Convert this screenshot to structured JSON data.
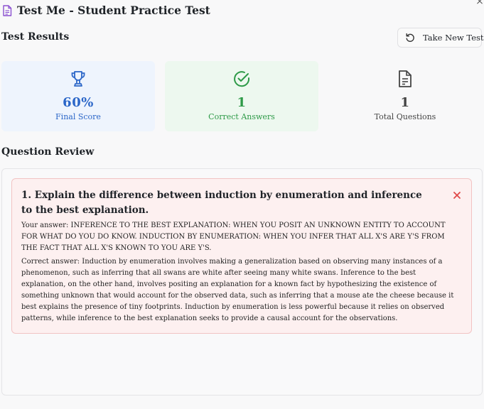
{
  "window": {
    "title": "Test Me - Student Practice Test",
    "icon": "document-icon",
    "close_label": "×"
  },
  "results": {
    "heading": "Test Results",
    "new_test_label": "Take New Test",
    "new_test_icon": "rotate-ccw-icon",
    "stats": [
      {
        "icon": "trophy-icon",
        "value": "60%",
        "label": "Final Score",
        "color": "#2b66c8"
      },
      {
        "icon": "check-circle-icon",
        "value": "1",
        "label": "Correct Answers",
        "color": "#2e9a48"
      },
      {
        "icon": "file-text-icon",
        "value": "1",
        "label": "Total Questions",
        "color": "#444444"
      }
    ]
  },
  "review": {
    "heading": "Question Review",
    "questions": [
      {
        "title": "1. Explain the difference between induction by enumeration and inference to the best explanation.",
        "status_icon": "x-icon",
        "status_color": "#e04848",
        "your_answer_prefix": "Your answer:",
        "your_answer": "INFERENCE TO THE BEST EXPLANATION: WHEN YOU POSIT AN UNKNOWN ENTITY TO ACCOUNT FOR WHAT DO YOU DO KNOW. INDUCTION BY ENUMERATION: WHEN YOU INFER THAT ALL X'S ARE Y'S FROM THE FACT THAT ALL X'S KNOWN TO YOU ARE Y'S.",
        "correct_answer_prefix": "Correct answer:",
        "correct_answer": "Induction by enumeration involves making a generalization based on observing many instances of a phenomenon, such as inferring that all swans are white after seeing many white swans. Inference to the best explanation, on the other hand, involves positing an explanation for a known fact by hypothesizing the existence of something unknown that would account for the observed data, such as inferring that a mouse ate the cheese because it best explains the presence of tiny footprints. Induction by enumeration is less powerful because it relies on observed patterns, while inference to the best explanation seeks to provide a causal account for the observations."
      }
    ]
  }
}
